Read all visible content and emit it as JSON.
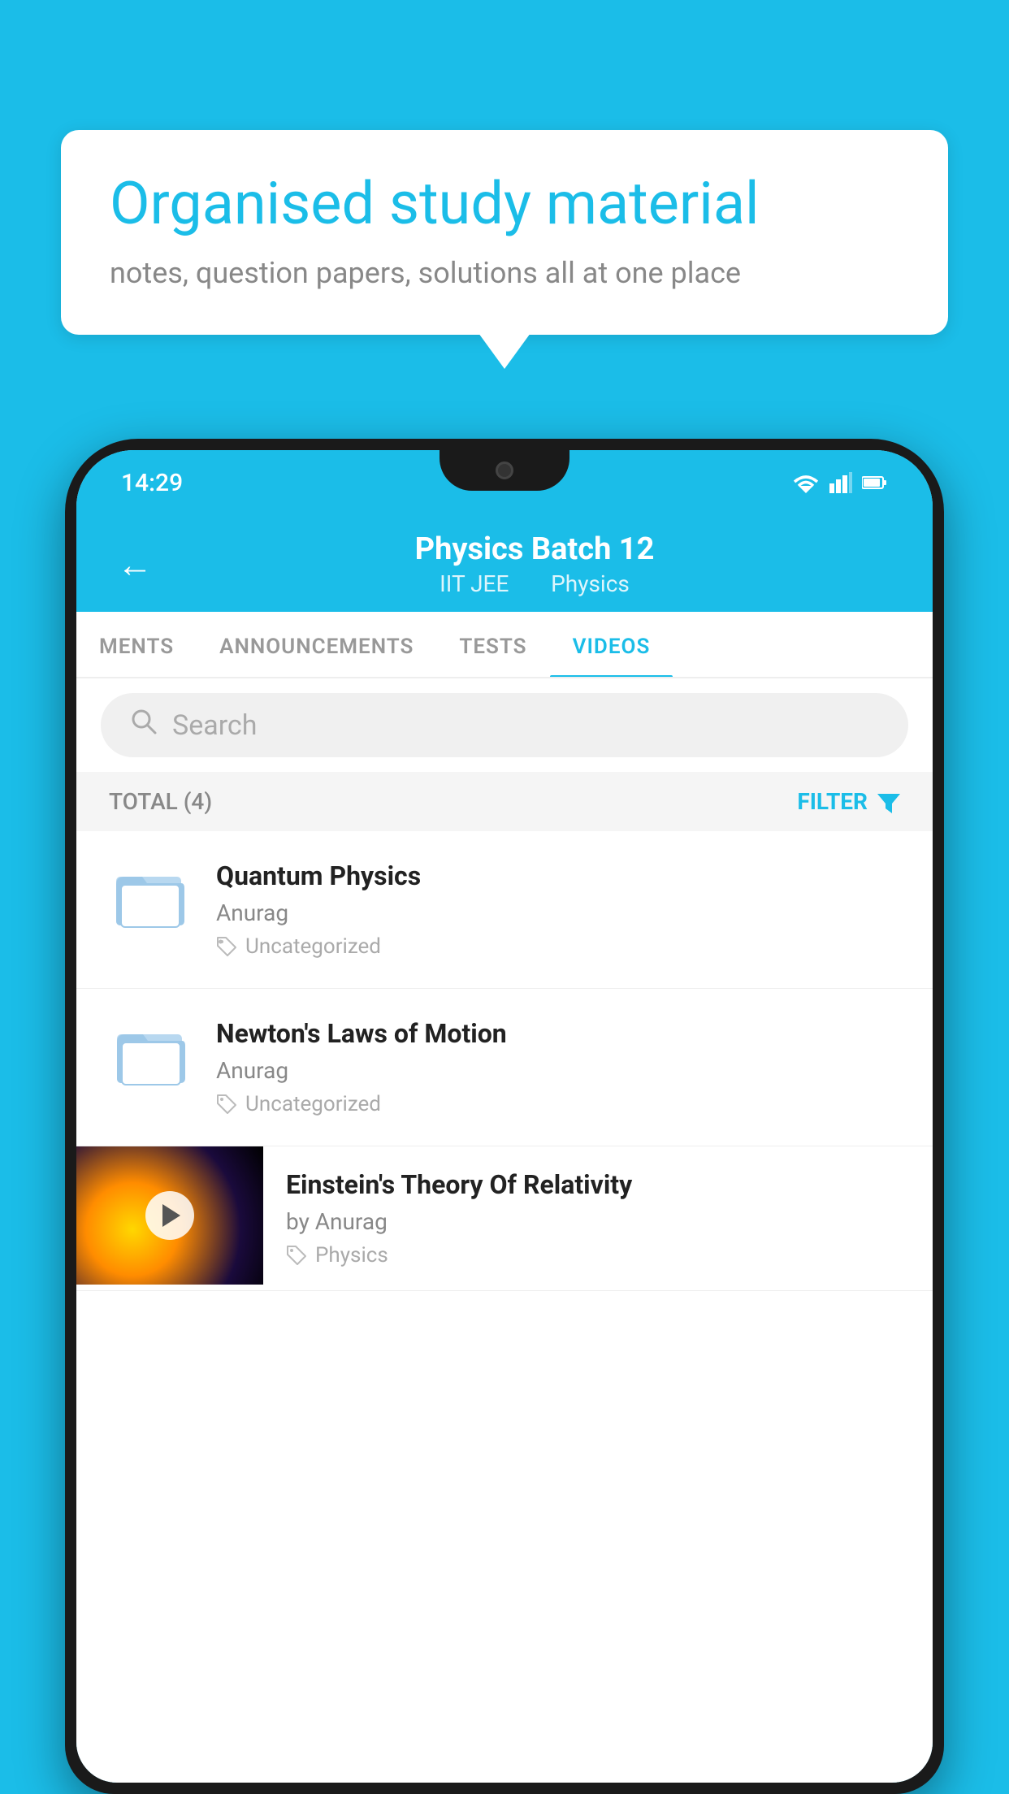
{
  "background_color": "#1BBDE8",
  "bubble": {
    "headline": "Organised study material",
    "subtext": "notes, question papers, solutions all at one place"
  },
  "status_bar": {
    "time": "14:29",
    "wifi_icon": "wifi",
    "signal_icon": "signal",
    "battery_icon": "battery"
  },
  "app_header": {
    "title": "Physics Batch 12",
    "subtitle_part1": "IIT JEE",
    "subtitle_part2": "Physics",
    "back_label": "←"
  },
  "tabs": [
    {
      "label": "MENTS",
      "active": false
    },
    {
      "label": "ANNOUNCEMENTS",
      "active": false
    },
    {
      "label": "TESTS",
      "active": false
    },
    {
      "label": "VIDEOS",
      "active": true
    }
  ],
  "search": {
    "placeholder": "Search"
  },
  "filter_row": {
    "total_label": "TOTAL (4)",
    "filter_label": "FILTER"
  },
  "videos": [
    {
      "title": "Quantum Physics",
      "author": "Anurag",
      "tag": "Uncategorized",
      "has_thumbnail": false
    },
    {
      "title": "Newton's Laws of Motion",
      "author": "Anurag",
      "tag": "Uncategorized",
      "has_thumbnail": false
    },
    {
      "title": "Einstein's Theory Of Relativity",
      "author": "by Anurag",
      "tag": "Physics",
      "has_thumbnail": true
    }
  ],
  "accent_color": "#1BBDE8"
}
